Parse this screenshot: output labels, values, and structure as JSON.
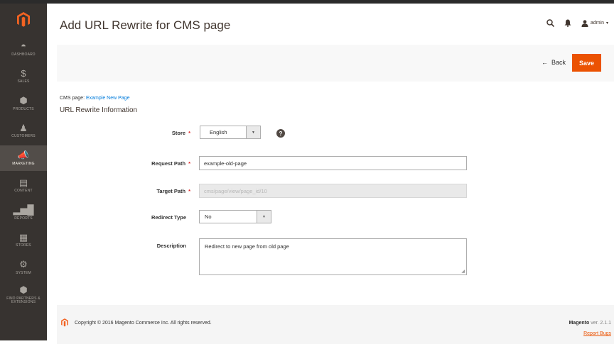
{
  "page": {
    "title": "Add URL Rewrite for CMS page"
  },
  "header": {
    "user": "admin"
  },
  "sidebar": {
    "items": [
      {
        "label": "DASHBOARD",
        "icon": "dashboard-icon",
        "glyph": "◓"
      },
      {
        "label": "SALES",
        "icon": "dollar-icon",
        "glyph": "$"
      },
      {
        "label": "PRODUCTS",
        "icon": "cube-icon",
        "glyph": "⬢"
      },
      {
        "label": "CUSTOMERS",
        "icon": "person-icon",
        "glyph": "♟"
      },
      {
        "label": "MARKETING",
        "icon": "megaphone-icon",
        "glyph": "📣"
      },
      {
        "label": "CONTENT",
        "icon": "layout-icon",
        "glyph": "▤"
      },
      {
        "label": "REPORTS",
        "icon": "bar-chart-icon",
        "glyph": "▂▅█"
      },
      {
        "label": "STORES",
        "icon": "store-icon",
        "glyph": "▦"
      },
      {
        "label": "SYSTEM",
        "icon": "gear-icon",
        "glyph": "⚙"
      },
      {
        "label": "FIND PARTNERS & EXTENSIONS",
        "icon": "partners-icon",
        "glyph": "⬢"
      }
    ],
    "active_index": 4
  },
  "actions": {
    "back_label": "Back",
    "save_label": "Save"
  },
  "cms": {
    "prefix": "CMS page:",
    "link": "Example New Page"
  },
  "section": {
    "title": "URL Rewrite Information"
  },
  "form": {
    "store": {
      "label": "Store",
      "value": "English"
    },
    "request_path": {
      "label": "Request Path",
      "value": "example-old-page"
    },
    "target_path": {
      "label": "Target Path",
      "value": "cms/page/view/page_id/10"
    },
    "redirect_type": {
      "label": "Redirect Type",
      "value": "No"
    },
    "description": {
      "label": "Description",
      "value": "Redirect to new page from old page"
    }
  },
  "footer": {
    "copyright": "Copyright © 2016 Magento Commerce Inc. All rights reserved.",
    "brand": "Magento",
    "version": "ver. 2.1.1",
    "report_bugs": "Report Bugs"
  },
  "colors": {
    "accent": "#eb5202",
    "sidebar": "#373330",
    "link": "#007bdb",
    "required": "#e22626"
  }
}
